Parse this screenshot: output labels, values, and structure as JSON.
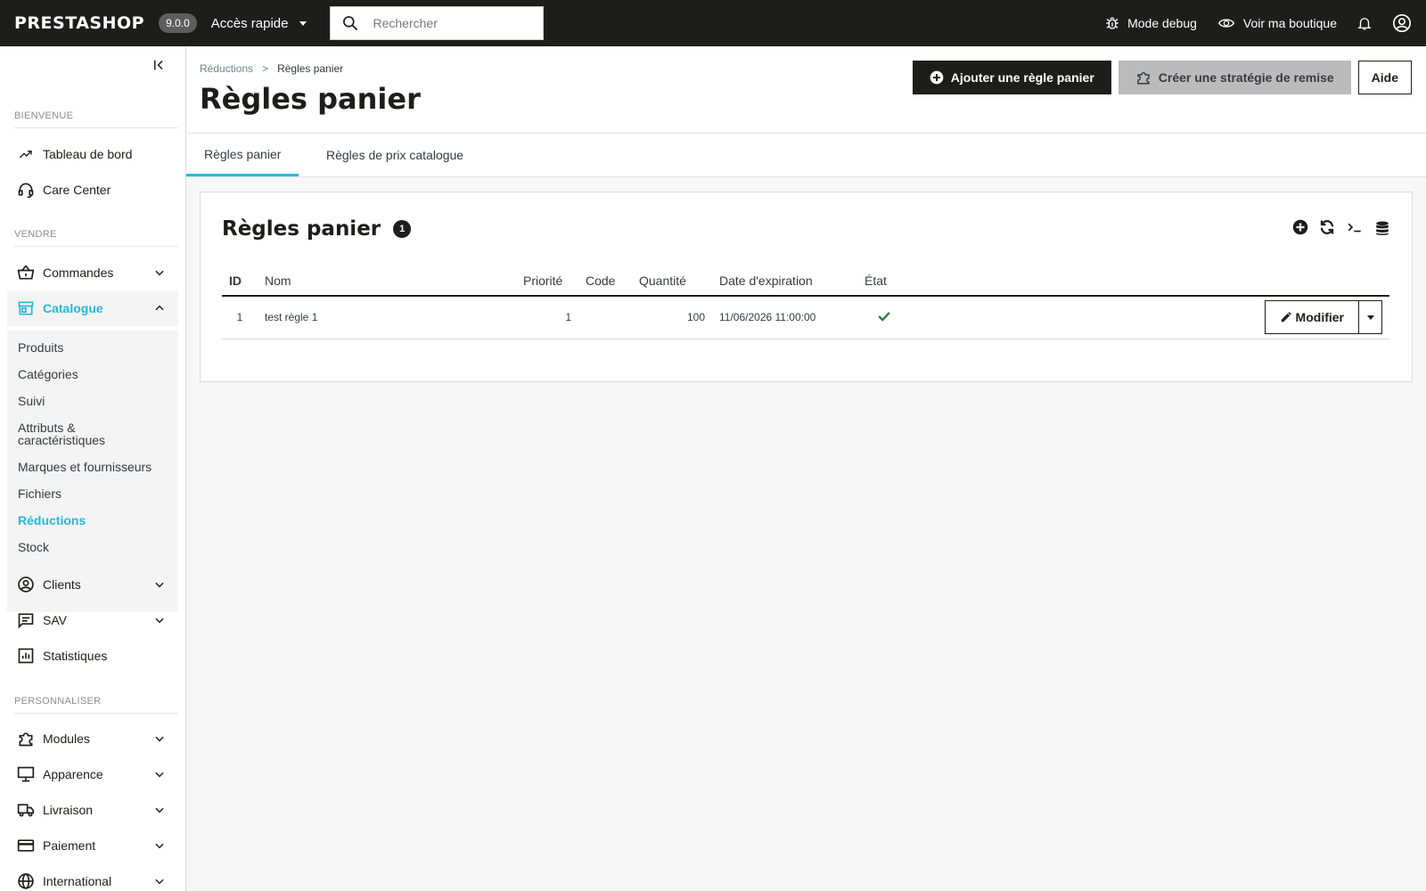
{
  "topbar": {
    "logo": "PRESTASHOP",
    "version": "9.0.0",
    "quick_access": "Accès rapide",
    "search_placeholder": "Rechercher",
    "debug_label": "Mode debug",
    "shop_label": "Voir ma boutique"
  },
  "sidebar": {
    "section_welcome": "BIENVENUE",
    "section_sell": "VENDRE",
    "section_customize": "PERSONNALISER",
    "items": {
      "dashboard": "Tableau de bord",
      "care": "Care Center",
      "orders": "Commandes",
      "catalog": "Catalogue",
      "clients": "Clients",
      "sav": "SAV",
      "stats": "Statistiques",
      "modules": "Modules",
      "appearance": "Apparence",
      "shipping": "Livraison",
      "payment": "Paiement",
      "international": "International"
    },
    "catalog_sub": {
      "products": "Produits",
      "categories": "Catégories",
      "monitoring": "Suivi",
      "attributes_line1": "Attributs &",
      "attributes_line2": "caractéristiques",
      "brands": "Marques et fournisseurs",
      "files": "Fichiers",
      "discounts": "Réductions",
      "stock": "Stock"
    }
  },
  "header": {
    "breadcrumb_parent": "Réductions",
    "breadcrumb_sep": ">",
    "breadcrumb_current": "Règles panier",
    "title": "Règles panier",
    "add_button": "Ajouter une règle panier",
    "strategy_button": "Créer une stratégie de remise",
    "help_button": "Aide"
  },
  "tabs": {
    "cart_rules": "Règles panier",
    "catalog_rules": "Règles de prix catalogue"
  },
  "card": {
    "title": "Règles panier",
    "count": "1"
  },
  "table": {
    "headers": {
      "id": "ID",
      "name": "Nom",
      "priority": "Priorité",
      "code": "Code",
      "quantity": "Quantité",
      "expiration": "Date d'expiration",
      "state": "État"
    },
    "rows": [
      {
        "id": "1",
        "name": "test règle 1",
        "priority": "1",
        "code": "",
        "quantity": "100",
        "expiration": "11/06/2026 11:00:00",
        "state": "enabled",
        "edit_label": "Modifier"
      }
    ]
  },
  "colors": {
    "topbar_bg": "#1d1d1b",
    "accent": "#25b9d7",
    "success": "#70b580"
  }
}
